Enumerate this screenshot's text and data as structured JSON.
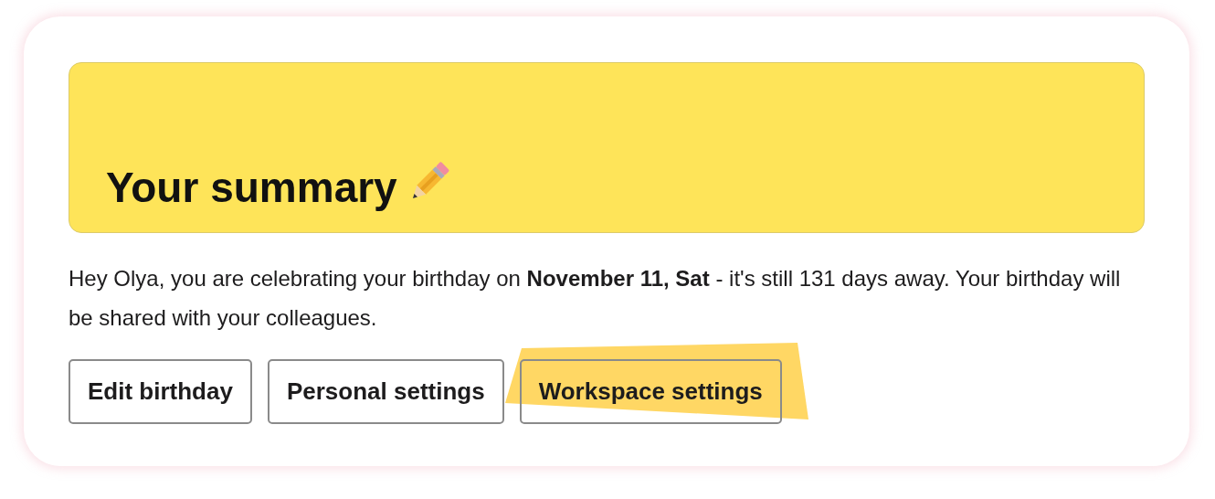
{
  "summary": {
    "title": "Your summary"
  },
  "message": "Hey Olya, you are celebrating your birthday on **November 11, Sat** - it's still 131 days away. Your birthday will be shared with your colleagues.",
  "buttons": [
    {
      "label": "Edit birthday",
      "highlighted": false
    },
    {
      "label": "Personal settings",
      "highlighted": false
    },
    {
      "label": "Workspace settings",
      "highlighted": true
    }
  ]
}
